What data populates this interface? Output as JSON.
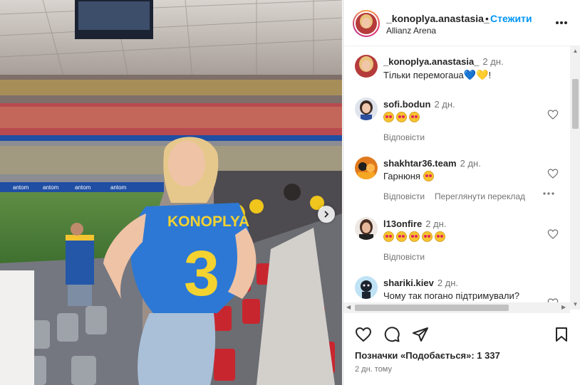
{
  "post": {
    "author": "_konoplya.anastasia_",
    "follow_label": "Стежити",
    "separator": "•",
    "location": "Allianz Arena",
    "more_icon": "more-horizontal-icon",
    "photo": {
      "jersey_name": "KONOPLYA",
      "jersey_number": "3",
      "board_text": "antom"
    }
  },
  "caption": {
    "user": "_konoplya.anastasia_",
    "time": "2 дн.",
    "text": "Тільки перемогаuа",
    "hearts": [
      "💙",
      "💛"
    ],
    "suffix": "!"
  },
  "comments": [
    {
      "user": "sofi.bodun",
      "time": "2 дн.",
      "text": "",
      "emoji_count": 3,
      "reply": "Відповісти"
    },
    {
      "user": "shakhtar36.team",
      "time": "2 дн.",
      "text": "Гарнюня",
      "emoji_count": 1,
      "reply": "Відповісти",
      "translate": "Переглянути переклад"
    },
    {
      "user": "l13onfire",
      "time": "2 дн.",
      "text": "",
      "emoji_count": 5,
      "reply": "Відповісти"
    },
    {
      "user": "shariki.kiev",
      "time": "2 дн.",
      "text": "Чому так погано підтримували?",
      "emoji_count": 0
    }
  ],
  "footer": {
    "likes_text": "Позначки «Подобається»: 1 337",
    "time_ago": "2 дн. тому"
  },
  "colors": {
    "accent": "#0095f6",
    "text": "#262626",
    "muted": "#737373"
  }
}
